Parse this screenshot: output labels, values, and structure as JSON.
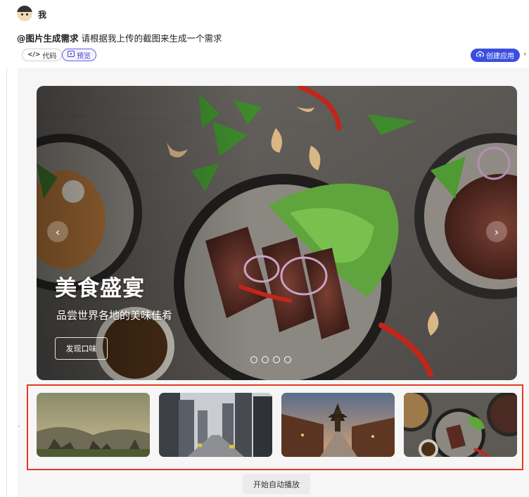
{
  "chat": {
    "username": "我",
    "prompt_mention": "@图片生成需求",
    "prompt_text": " 请根据我上传的截图来生成一个需求"
  },
  "toolbar": {
    "code_label": "代码",
    "preview_label": "预览",
    "create_app_label": "创建应用"
  },
  "hero": {
    "title": "美食盛宴",
    "subtitle": "品尝世界各地的美味佳肴",
    "cta_label": "发现口味",
    "slide_count": 4
  },
  "thumbnails": [
    {
      "name": "thumb-mountain",
      "subject": "misty mountain landscape"
    },
    {
      "name": "thumb-city",
      "subject": "city street with skyscrapers"
    },
    {
      "name": "thumb-old-town",
      "subject": "traditional street with pagoda at dusk"
    },
    {
      "name": "thumb-food",
      "subject": "plates of grilled beef salad"
    }
  ],
  "footer": {
    "autoplay_label": "开始自动播放"
  },
  "colors": {
    "accent_blue": "#3a4fe0",
    "preview_purple": "#4a3dc9",
    "selection_red": "#e53a20",
    "panel_bg": "#f6f6f7"
  },
  "icons": {
    "code": "code-icon",
    "preview": "preview-icon",
    "create_app": "cloud-upload-icon",
    "prev": "chevron-left-icon",
    "next": "chevron-right-icon",
    "more": "chevron-right-icon"
  }
}
